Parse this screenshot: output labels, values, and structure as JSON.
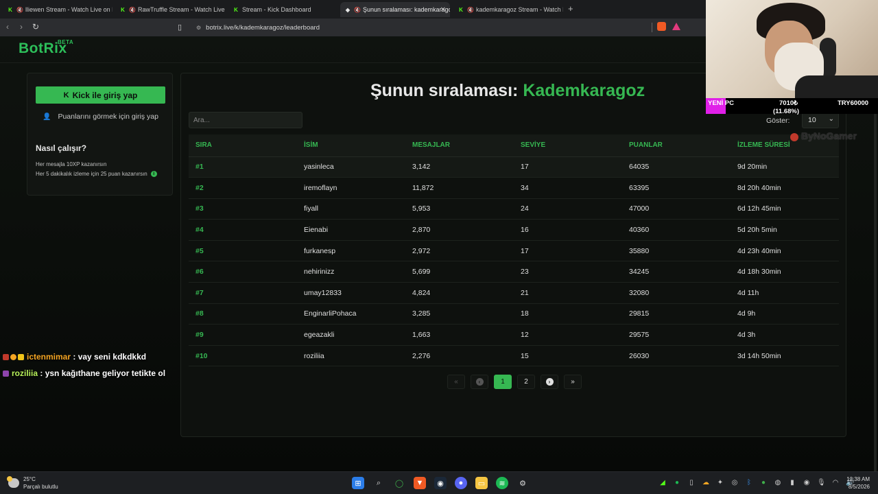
{
  "browser": {
    "tabs": [
      {
        "title": "lliewen Stream - Watch Live on Ki",
        "muted": true
      },
      {
        "title": "RawTruffle Stream - Watch Live o",
        "muted": true
      },
      {
        "title": "Stream - Kick Dashboard",
        "muted": false
      },
      {
        "title": "Şunun sıralaması: kademkaragoz",
        "muted": true,
        "active": true
      },
      {
        "title": "kademkaragoz Stream - Watch Li",
        "muted": true
      }
    ],
    "url": "botrix.live/k/kademkaragoz/leaderboard"
  },
  "site": {
    "logo": "BotRix",
    "logo_badge": "BETA"
  },
  "sidebar": {
    "login_button": "Kick ile giriş yap",
    "points_link": "Puanlarını görmek için giriş yap",
    "how_title": "Nasıl çalışır?",
    "how_line1": "Her mesajla 10XP kazanırsın",
    "how_line2": "Her 5 dakikalık izleme için 25 puan kazanırsın"
  },
  "main": {
    "heading_prefix": "Şunun sıralaması:",
    "heading_name": "Kademkaragoz",
    "search_placeholder": "Ara...",
    "show_label": "Göster:",
    "show_value": "10",
    "columns": [
      "SIRA",
      "İSİM",
      "MESAJLAR",
      "SEVİYE",
      "PUANLAR",
      "İZLEME SÜRESİ"
    ],
    "rows": [
      {
        "rank": "#1",
        "name": "yasinleca",
        "messages": "3,142",
        "level": "17",
        "points": "64035",
        "watch": "9d 20min"
      },
      {
        "rank": "#2",
        "name": "iremoflayn",
        "messages": "11,872",
        "level": "34",
        "points": "63395",
        "watch": "8d 20h 40min"
      },
      {
        "rank": "#3",
        "name": "fiyall",
        "messages": "5,953",
        "level": "24",
        "points": "47000",
        "watch": "6d 12h 45min"
      },
      {
        "rank": "#4",
        "name": "Eienabi",
        "messages": "2,870",
        "level": "16",
        "points": "40360",
        "watch": "5d 20h 5min"
      },
      {
        "rank": "#5",
        "name": "furkanesp",
        "messages": "2,972",
        "level": "17",
        "points": "35880",
        "watch": "4d 23h 40min"
      },
      {
        "rank": "#6",
        "name": "nehirinizz",
        "messages": "5,699",
        "level": "23",
        "points": "34245",
        "watch": "4d 18h 30min"
      },
      {
        "rank": "#7",
        "name": "umay12833",
        "messages": "4,824",
        "level": "21",
        "points": "32080",
        "watch": "4d 11h"
      },
      {
        "rank": "#8",
        "name": "EnginarliPohaca",
        "messages": "3,285",
        "level": "18",
        "points": "29815",
        "watch": "4d 9h"
      },
      {
        "rank": "#9",
        "name": "egeazakli",
        "messages": "1,663",
        "level": "12",
        "points": "29575",
        "watch": "4d 3h"
      },
      {
        "rank": "#10",
        "name": "roziliia",
        "messages": "2,276",
        "level": "15",
        "points": "26030",
        "watch": "3d 14h 50min"
      }
    ],
    "pager": {
      "first": "«",
      "prev": "‹",
      "page1": "1",
      "page2": "2",
      "next": "›",
      "last": "»"
    }
  },
  "chat": [
    {
      "user": "ictenmimar",
      "text": ": vay seni kdkdkkd"
    },
    {
      "user": "roziliia",
      "text": ": ysn kağıthane geliyor tetikte ol"
    }
  ],
  "sponsor": {
    "label": "YENİ PC",
    "amount": "7010₺",
    "percent": "(11.68%)",
    "goal": "TRY60000"
  },
  "watermark": "ByNoGamer",
  "taskbar": {
    "temp": "25°C",
    "weather": "Parçalı bulutlu",
    "time": "12:38 AM",
    "date": "8/5/2026"
  },
  "colors": {
    "accent": "#36b852",
    "kick": "#53fc18",
    "background": "#0b0d0b"
  }
}
